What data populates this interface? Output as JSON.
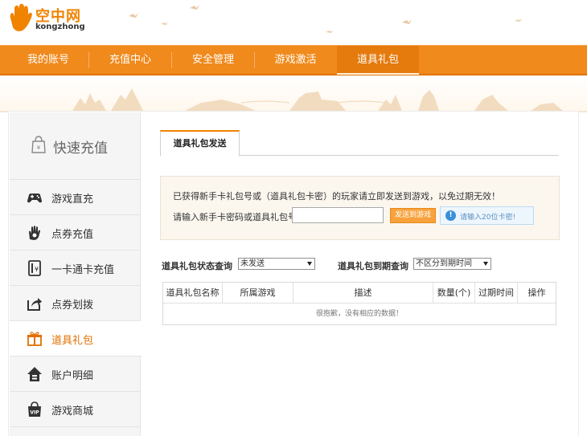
{
  "header": {
    "logo_cn": "空中网",
    "logo_en": "kongzhong"
  },
  "nav": {
    "items": [
      {
        "label": "我的账号"
      },
      {
        "label": "充值中心"
      },
      {
        "label": "安全管理"
      },
      {
        "label": "游戏激活"
      },
      {
        "label": "道具礼包"
      }
    ],
    "active": "道具礼包"
  },
  "sidebar": {
    "quick_label": "快速充值",
    "items": [
      {
        "label": "游戏直充",
        "icon": "gamepad-icon"
      },
      {
        "label": "点券充值",
        "icon": "hand-coin-icon"
      },
      {
        "label": "一卡通卡充值",
        "icon": "card-icon"
      },
      {
        "label": "点券划拨",
        "icon": "transfer-icon"
      },
      {
        "label": "道具礼包",
        "icon": "gift-icon",
        "active": true
      },
      {
        "label": "账户明细",
        "icon": "house-icon"
      },
      {
        "label": "游戏商城",
        "icon": "vip-bag-icon"
      }
    ]
  },
  "main": {
    "tab_label": "道具礼包发送",
    "send": {
      "description": "已获得新手卡礼包号或（道具礼包卡密）的玩家请立即发送到游戏，以免过期无效！",
      "input_label": "请输入新手卡密码或道具礼包号",
      "input_value": "",
      "button_label": "发送到游戏",
      "hint": "请输入20位卡密!"
    },
    "filters": {
      "status_label": "道具礼包状态查询",
      "status_value": "未发送",
      "expiry_label": "道具礼包到期查询",
      "expiry_value": "不区分到期时间"
    },
    "table": {
      "columns": [
        "道具礼包名称",
        "所属游戏",
        "描述",
        "数量(个)",
        "过期时间",
        "操作"
      ],
      "empty_text": "很抱歉，没有相应的数据！"
    }
  },
  "colors": {
    "brand_orange": "#f08a1c",
    "active_text": "#e07000",
    "hint_blue": "#3a8fd8"
  }
}
